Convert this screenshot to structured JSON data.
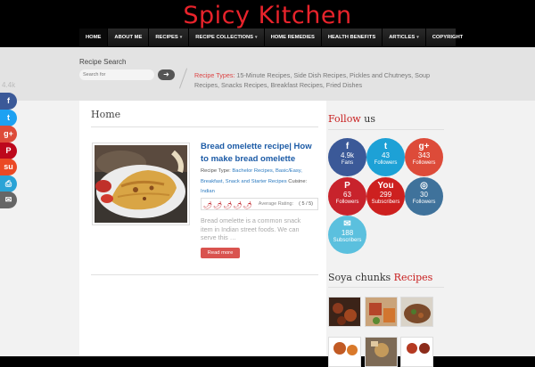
{
  "site": {
    "title": "Spicy Kitchen"
  },
  "nav": [
    {
      "label": "HOME",
      "active": true,
      "caret": ""
    },
    {
      "label": "ABOUT ME",
      "caret": ""
    },
    {
      "label": "RECIPES",
      "caret": "▾"
    },
    {
      "label": "RECIPE COLLECTIONS",
      "caret": "▾"
    },
    {
      "label": "HOME REMEDIES",
      "caret": ""
    },
    {
      "label": "HEALTH BENEFITS",
      "caret": ""
    },
    {
      "label": "ARTICLES",
      "caret": "▾"
    },
    {
      "label": "COPYRIGHT",
      "caret": ""
    }
  ],
  "search": {
    "title": "Recipe Search",
    "placeholder": "Search for",
    "button_icon": "➜",
    "recipe_types_label": "Recipe Types:",
    "recipe_types_list": "15-Minute Recipes, Side Dish Recipes, Pickles and Chutneys, Soup Recipes, Snacks Recipes, Breakfast Recipes, Fried Dishes"
  },
  "main": {
    "title": "Home",
    "post": {
      "title": "Bread omelette recipe| How to make bread omelette",
      "recipe_type_label": "Recipe Type:",
      "recipe_types": "Bachelor Recipes, Basic/Easy, Breakfast, Snack and Starter Recipes",
      "cuisine_label": "Cuisine:",
      "cuisine": "Indian",
      "rating_label": "Average Rating:",
      "rating_display": "( 5 / 5)",
      "rating": 5,
      "rating_max": 5,
      "excerpt": "Bread omelette is a common snack item in Indian street foods. We can serve this …",
      "read_more": "Read more"
    }
  },
  "sidebar": {
    "follow_prefix": "Follow",
    "follow_suffix": "us",
    "social": [
      {
        "icon": "f",
        "count": "4.9k",
        "label": "Fans",
        "color": "#3b5998"
      },
      {
        "icon": "t",
        "count": "43",
        "label": "Followers",
        "color": "#1da1d6"
      },
      {
        "icon": "g+",
        "count": "343",
        "label": "Followers",
        "color": "#dd4b39"
      },
      {
        "icon": "P",
        "count": "63",
        "label": "Followers",
        "color": "#c8232c"
      },
      {
        "icon": "You",
        "count": "299",
        "label": "Subscribers",
        "color": "#cd201f"
      },
      {
        "icon": "◎",
        "count": "30",
        "label": "Followers",
        "color": "#3f729b"
      },
      {
        "icon": "✉",
        "count": "188",
        "label": "Subscribers",
        "color": "#5bc0de"
      }
    ],
    "soya_prefix": "Soya chunks",
    "soya_suffix": "Recipes"
  },
  "share": {
    "count": "4.4k",
    "buttons": [
      {
        "icon": "f",
        "color": "#3b5998"
      },
      {
        "icon": "t",
        "color": "#1da1f2"
      },
      {
        "icon": "g+",
        "color": "#dd4b39"
      },
      {
        "icon": "P",
        "color": "#bd081c"
      },
      {
        "icon": "su",
        "color": "#eb4924"
      },
      {
        "icon": "⎙",
        "color": "#2aa3d6"
      },
      {
        "icon": "✉",
        "color": "#666666"
      }
    ]
  }
}
